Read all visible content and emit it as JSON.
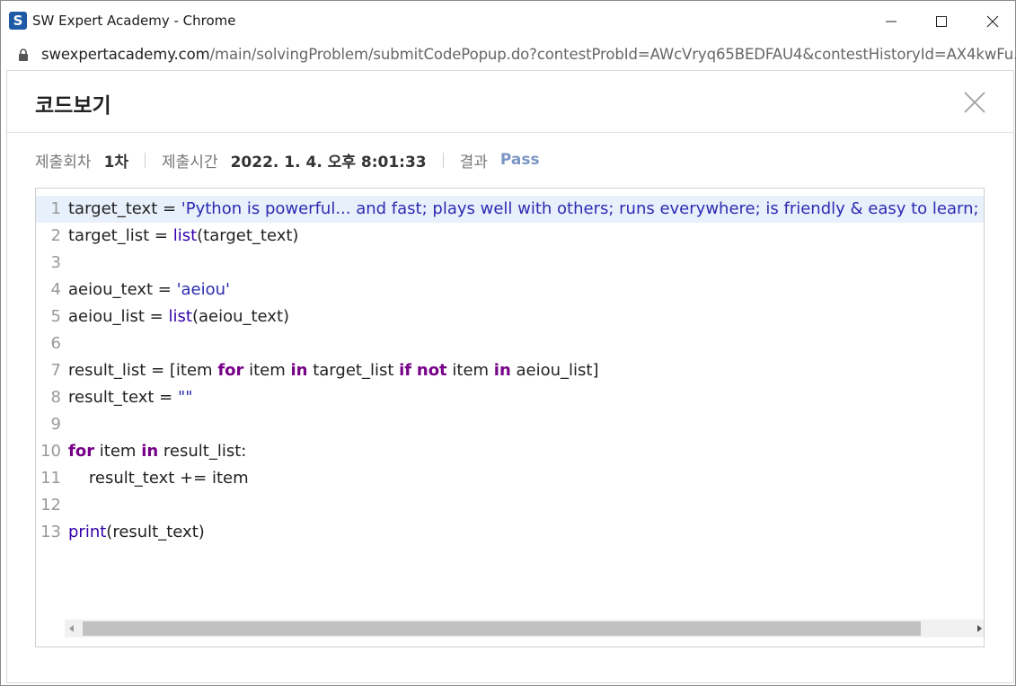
{
  "window": {
    "title": "SW Expert Academy - Chrome",
    "app_icon_letter": "S",
    "controls": {
      "minimize": "minimize-icon",
      "maximize": "maximize-icon",
      "close": "close-icon"
    }
  },
  "address_bar": {
    "domain": "swexpertacademy.com",
    "path": "/main/solvingProblem/submitCodePopup.do?contestProbId=AWcVryq65BEDFAU4&contestHistoryId=AX4kwFu..."
  },
  "popup": {
    "title": "코드보기",
    "meta": {
      "submission_label": "제출회차",
      "submission_value": "1차",
      "time_label": "제출시간",
      "time_value": "2022. 1. 4. 오후 8:01:33",
      "result_label": "결과",
      "result_value": "Pass"
    },
    "colors": {
      "pass": "#7b96c4",
      "string": "#2b2bb0",
      "keyword": "#770088",
      "builtin": "#3300aa",
      "active_line": "#e8f0fc"
    },
    "code": {
      "active_line": 1,
      "lines": [
        {
          "n": "1",
          "tokens": [
            [
              "target_text = ",
              ""
            ],
            [
              "'Python is powerful... and fast; plays well with others; runs everywhere; is friendly & easy to learn; is Open",
              "str"
            ]
          ]
        },
        {
          "n": "2",
          "tokens": [
            [
              "target_list = ",
              ""
            ],
            [
              "list",
              "builtin"
            ],
            [
              "(target_text)",
              ""
            ]
          ]
        },
        {
          "n": "3",
          "tokens": []
        },
        {
          "n": "4",
          "tokens": [
            [
              "aeiou_text = ",
              ""
            ],
            [
              "'aeiou'",
              "str"
            ]
          ]
        },
        {
          "n": "5",
          "tokens": [
            [
              "aeiou_list = ",
              ""
            ],
            [
              "list",
              "builtin"
            ],
            [
              "(aeiou_text)",
              ""
            ]
          ]
        },
        {
          "n": "6",
          "tokens": []
        },
        {
          "n": "7",
          "tokens": [
            [
              "result_list = [item ",
              ""
            ],
            [
              "for",
              "kw"
            ],
            [
              " item ",
              ""
            ],
            [
              "in",
              "kw"
            ],
            [
              " target_list ",
              ""
            ],
            [
              "if",
              "kw"
            ],
            [
              " ",
              ""
            ],
            [
              "not",
              "kw"
            ],
            [
              " item ",
              ""
            ],
            [
              "in",
              "kw"
            ],
            [
              " aeiou_list]",
              ""
            ]
          ]
        },
        {
          "n": "8",
          "tokens": [
            [
              "result_text = ",
              ""
            ],
            [
              "\"\"",
              "str"
            ]
          ]
        },
        {
          "n": "9",
          "tokens": []
        },
        {
          "n": "10",
          "tokens": [
            [
              "for",
              "kw"
            ],
            [
              " item ",
              ""
            ],
            [
              "in",
              "kw"
            ],
            [
              " result_list:",
              ""
            ]
          ]
        },
        {
          "n": "11",
          "tokens": [
            [
              "    result_text += item",
              ""
            ]
          ]
        },
        {
          "n": "12",
          "tokens": []
        },
        {
          "n": "13",
          "tokens": [
            [
              "print",
              "builtin"
            ],
            [
              "(result_text)",
              ""
            ]
          ]
        }
      ]
    }
  }
}
